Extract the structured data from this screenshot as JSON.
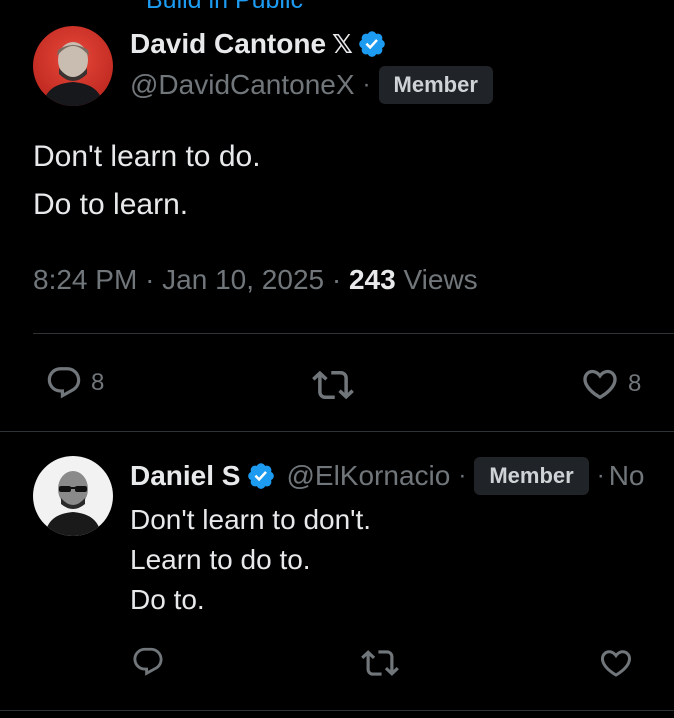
{
  "context_label": "Build in Public",
  "main_tweet": {
    "author": {
      "name": "David Cantone",
      "handle": "@DavidCantoneX",
      "badge": "Member",
      "x_mark": "𝕏"
    },
    "text": "Don't learn to do.\nDo to learn.",
    "time": "8:24 PM",
    "date": "Jan 10, 2025",
    "views_count": "243",
    "views_label": "Views",
    "separator": "·",
    "actions": {
      "reply_count": "8",
      "like_count": "8"
    }
  },
  "reply_tweet": {
    "author": {
      "name": "Daniel S",
      "handle": "@ElKornacio",
      "badge": "Member",
      "date_partial": "No"
    },
    "text": "Don't learn to don't.\nLearn to do to.\nDo to."
  },
  "colors": {
    "background": "#000000",
    "text_primary": "#e7e9ea",
    "text_secondary": "#71767b",
    "verified_blue": "#1d9bf0",
    "divider": "#2f3336",
    "badge_bg": "#202327"
  },
  "icons": [
    "x-logo-icon",
    "verified-icon",
    "reply-icon",
    "retweet-icon",
    "like-icon"
  ]
}
